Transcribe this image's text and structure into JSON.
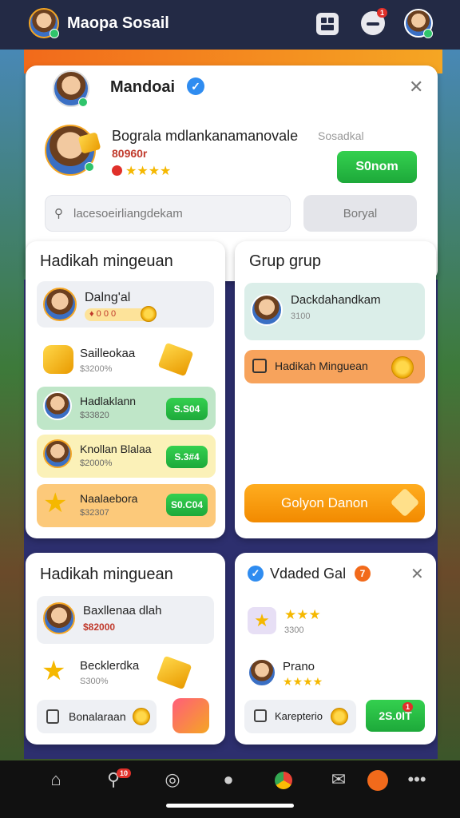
{
  "header": {
    "app_title": "Maopa Sosail",
    "notif_badge": "1"
  },
  "profile_card": {
    "name": "Mandoai",
    "headline": "Bograla mdlankanamanovale",
    "headline_suffix": "Sosadkal",
    "sub_value": "80960r",
    "stars": "★★★★",
    "action_label": "S0nom",
    "search_placeholder": "lacesoeirliangdekam",
    "search_button": "Boryal"
  },
  "weekly_card": {
    "title": "Hadikah mingeuan",
    "top_user": {
      "name": "Dalng'al",
      "sub": "♦ 0 0 0"
    },
    "items": [
      {
        "title": "Sailleokaa",
        "sub": "$3200%",
        "price": ""
      },
      {
        "title": "Hadlaklann",
        "sub": "$33820",
        "price": "S.S04"
      },
      {
        "title": "Knollan Blalaa",
        "sub": "$2000%",
        "price": "S.3#4"
      },
      {
        "title": "Naalaebora",
        "sub": "$32307",
        "price": "S0.C04"
      }
    ]
  },
  "group_card": {
    "title": "Grup grup",
    "user": {
      "name": "Dackdahandkam",
      "sub": "3100"
    },
    "reward_label": "Hadikah Minguean",
    "cta_label": "Golyon Danon"
  },
  "weekly_card2": {
    "title": "Hadikah minguean",
    "user": {
      "name": "Baxllenaa dlah",
      "sub": "$82000"
    },
    "item": {
      "title": "Becklerdka",
      "sub": "S300%"
    },
    "pill_label": "Bonalaraan"
  },
  "verified_card": {
    "title": "Vdaded Gal",
    "title_badge": "7",
    "rating_stars": "★★★",
    "rating_sub": "3300",
    "user": {
      "name": "Prano",
      "stars": "★★★★"
    },
    "pill_label": "Karepterio",
    "button_label": "2S.0IT",
    "button_badge": "1"
  },
  "nav": {
    "badge": "10"
  },
  "colors": {
    "accent_green": "#1da93a",
    "accent_orange": "#f5a623",
    "verified_blue": "#2f8cf0",
    "topbar": "#232a45"
  }
}
